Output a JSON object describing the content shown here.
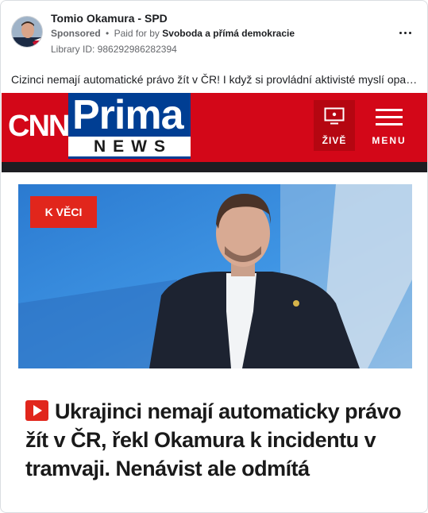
{
  "post": {
    "author": "Tomio Okamura - SPD",
    "sponsored": "Sponsored",
    "separator": "•",
    "paid_for_by": "Paid for by",
    "payer": "Svoboda a přímá demokracie",
    "library_id": "Library ID: 986292986282394",
    "caption": "Cizinci nemají automatické právo žít v ČR! I když si provládní aktivisté myslí opak..."
  },
  "banner": {
    "cnn": "CNN",
    "prima": "Prima",
    "news": "NEWS",
    "live_label": "ŽIVĚ",
    "menu_label": "MENU",
    "colors": {
      "red": "#d30718",
      "blue": "#003e93"
    }
  },
  "article": {
    "tag": "K VĚCI",
    "headline": "Ukrajinci nemají automaticky právo žít v ČR, řekl Okamura k incidentu v tramvaji. Nenávist ale odmítá"
  },
  "icons": [
    "more-options-icon",
    "tv-icon",
    "hamburger-menu-icon",
    "play-icon"
  ]
}
